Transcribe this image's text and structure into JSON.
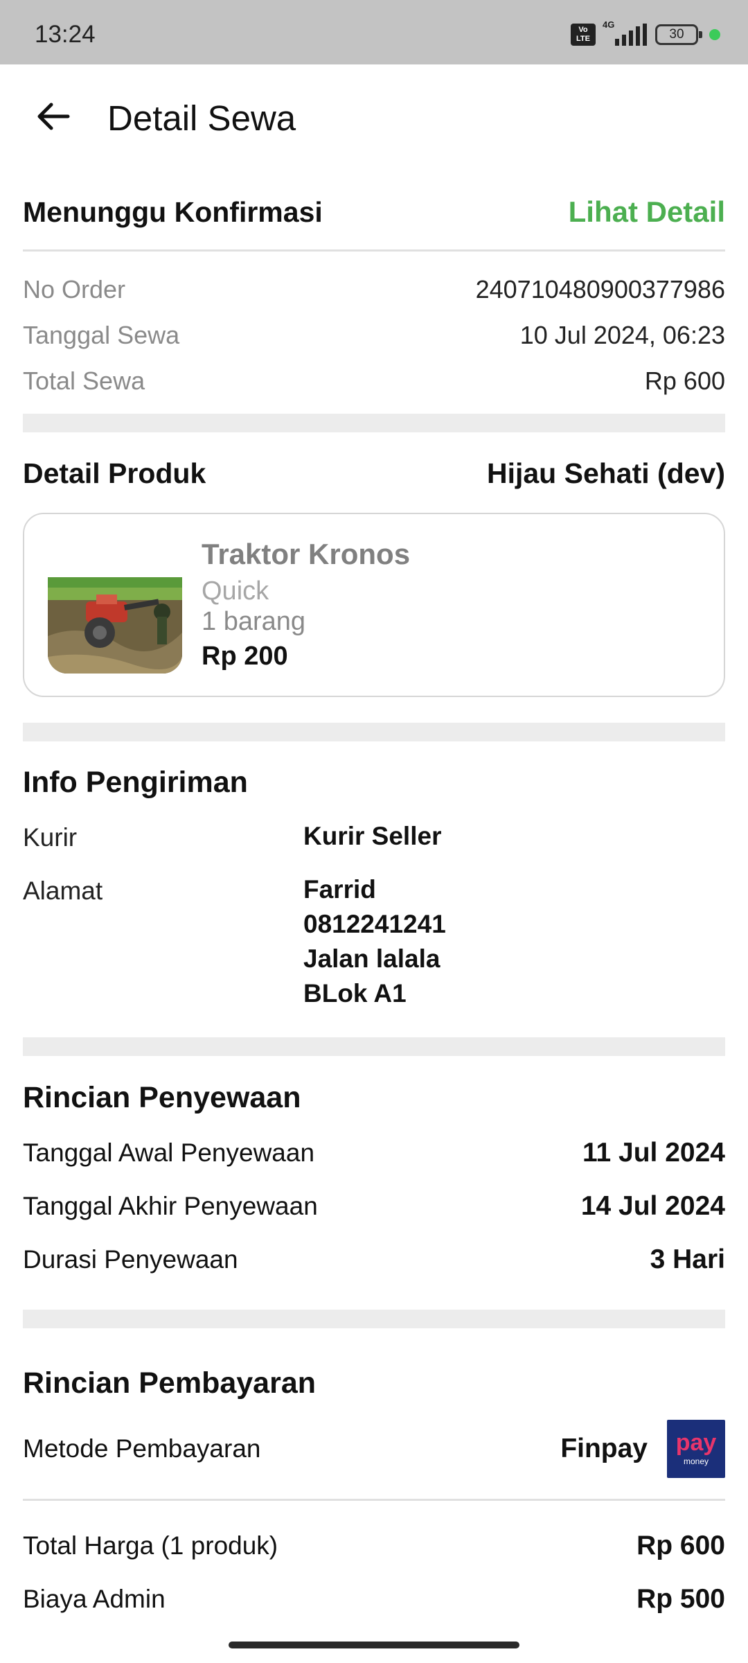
{
  "status_bar": {
    "time": "13:24",
    "volte": "Vo LTE",
    "network": "4G",
    "battery": "30"
  },
  "header": {
    "title": "Detail Sewa",
    "back_icon": "arrow-left-icon"
  },
  "order_status": {
    "label": "Menunggu Konfirmasi",
    "link": "Lihat Detail",
    "link_color": "#4caf50"
  },
  "order_info": [
    {
      "label": "No Order",
      "value": "240710480900377986"
    },
    {
      "label": "Tanggal Sewa",
      "value": "10 Jul 2024, 06:23"
    },
    {
      "label": "Total Sewa",
      "value": "Rp 600"
    }
  ],
  "product_section": {
    "title": "Detail Produk",
    "store": "Hijau Sehati (dev)",
    "product": {
      "name": "Traktor Kronos",
      "variant": "Quick",
      "quantity": "1 barang",
      "price": "Rp 200"
    }
  },
  "shipping": {
    "title": "Info Pengiriman",
    "courier_label": "Kurir",
    "courier_value": "Kurir Seller",
    "address_label": "Alamat",
    "address_lines": [
      "Farrid",
      "0812241241",
      "Jalan lalala",
      "BLok A1"
    ]
  },
  "rental": {
    "title": "Rincian Penyewaan",
    "rows": [
      {
        "label": "Tanggal Awal Penyewaan",
        "value": "11 Jul 2024"
      },
      {
        "label": "Tanggal Akhir Penyewaan",
        "value": "14 Jul 2024"
      },
      {
        "label": "Durasi Penyewaan",
        "value": "3 Hari"
      }
    ]
  },
  "payment": {
    "title": "Rincian Pembayaran",
    "method_label": "Metode Pembayaran",
    "method_value": "Finpay",
    "logo_text": "pay",
    "logo_subtext": "money",
    "rows": [
      {
        "label": "Total Harga (1 produk)",
        "value": "Rp 600"
      },
      {
        "label": "Biaya Admin",
        "value": "Rp 500"
      }
    ]
  }
}
